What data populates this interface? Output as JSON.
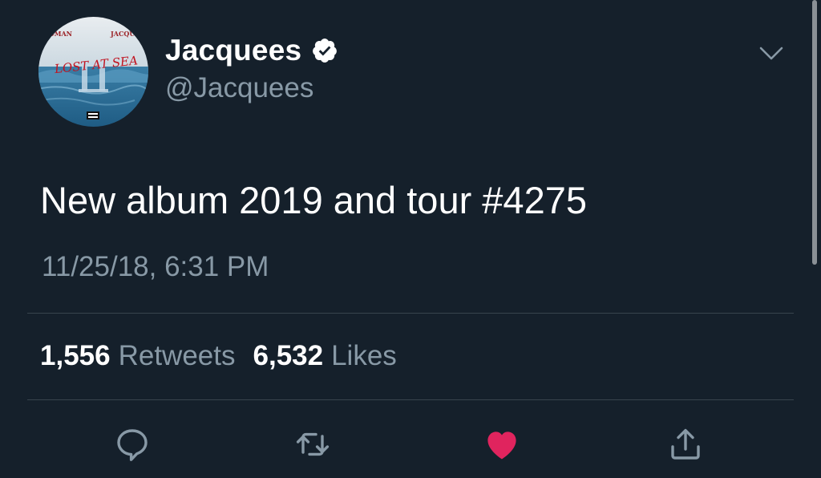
{
  "user": {
    "display_name": "Jacquees",
    "handle": "@Jacquees",
    "verified": true,
    "avatar_text": {
      "left": "RDMAN",
      "right": "JACQUE",
      "title": "LOST AT SEA"
    }
  },
  "tweet": {
    "text": "New album 2019 and tour #4275",
    "timestamp": "11/25/18, 6:31 PM"
  },
  "stats": {
    "retweets_count": "1,556",
    "retweets_label": "Retweets",
    "likes_count": "6,532",
    "likes_label": "Likes"
  },
  "actions": [
    {
      "name": "reply",
      "icon": "reply-icon"
    },
    {
      "name": "retweet",
      "icon": "retweet-icon"
    },
    {
      "name": "like",
      "icon": "heart-icon",
      "active": true
    },
    {
      "name": "share",
      "icon": "share-icon"
    }
  ],
  "colors": {
    "background": "#15202b",
    "secondary_text": "#8899a6",
    "divider": "#38444d",
    "like_active": "#e0245e",
    "action_icon": "#8899a6"
  }
}
